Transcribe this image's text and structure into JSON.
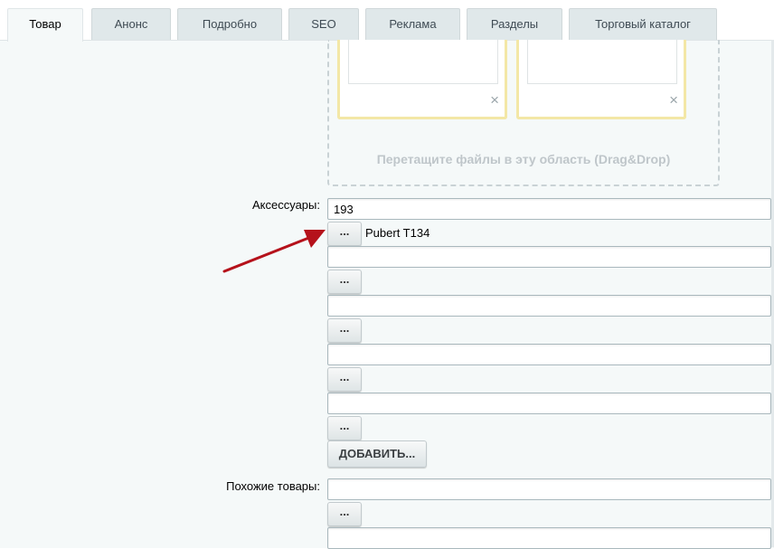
{
  "tabs": [
    {
      "label": "Товар",
      "active": true
    },
    {
      "label": "Анонс"
    },
    {
      "label": "Подробно"
    },
    {
      "label": "SEO"
    },
    {
      "label": "Реклама"
    },
    {
      "label": "Разделы"
    },
    {
      "label": "Торговый каталог"
    }
  ],
  "dropzone": {
    "text": "Перетащите файлы в эту область (Drag&Drop)",
    "close_glyph": "×"
  },
  "accessories": {
    "label": "Аксессуары:",
    "values": [
      "193",
      "",
      "",
      "",
      ""
    ],
    "picked_name": "Pubert T134",
    "pick_button_label": "...",
    "add_button_label": "ДОБАВИТЬ..."
  },
  "similar": {
    "label": "Похожие товары:",
    "values": [
      "",
      ""
    ],
    "pick_button_label": "..."
  },
  "colors": {
    "annotation_arrow": "#b5121b",
    "tab_bg": "#e0e8ea",
    "content_bg": "#f5f9f9"
  }
}
